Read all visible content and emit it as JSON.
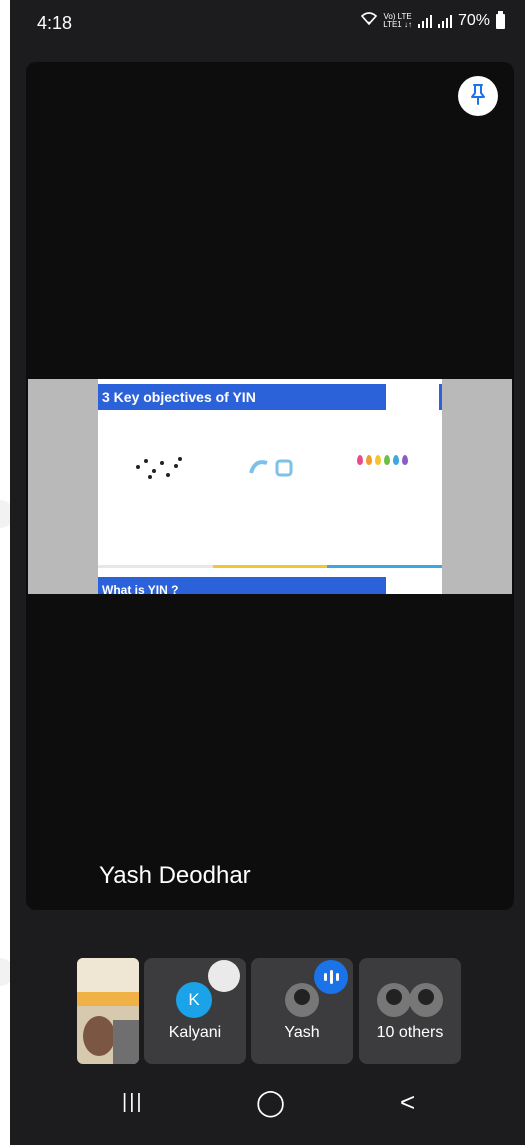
{
  "status_bar": {
    "time": "4:18",
    "network_top": "Vo) LTE",
    "network_bottom": "LTE1 ↓↑",
    "battery": "70%"
  },
  "stage": {
    "pin_icon": "pin-icon",
    "presenter_name": "Yash Deodhar",
    "shared_slide": {
      "title": "3 Key objectives of YIN",
      "next_title": "What is YIN ?"
    }
  },
  "participants": {
    "self": {
      "type": "self-video"
    },
    "tiles": [
      {
        "label": "Kalyani",
        "initial": "K",
        "state": "muted"
      },
      {
        "label": "Yash",
        "state": "speaking"
      },
      {
        "label": "10 others"
      }
    ]
  },
  "nav": {
    "recents": "|||",
    "home": "◯",
    "back": "<"
  },
  "colors": {
    "accent": "#1a73e8",
    "avatar": "#1aa3e8",
    "slide_blue": "#2c62d9"
  }
}
